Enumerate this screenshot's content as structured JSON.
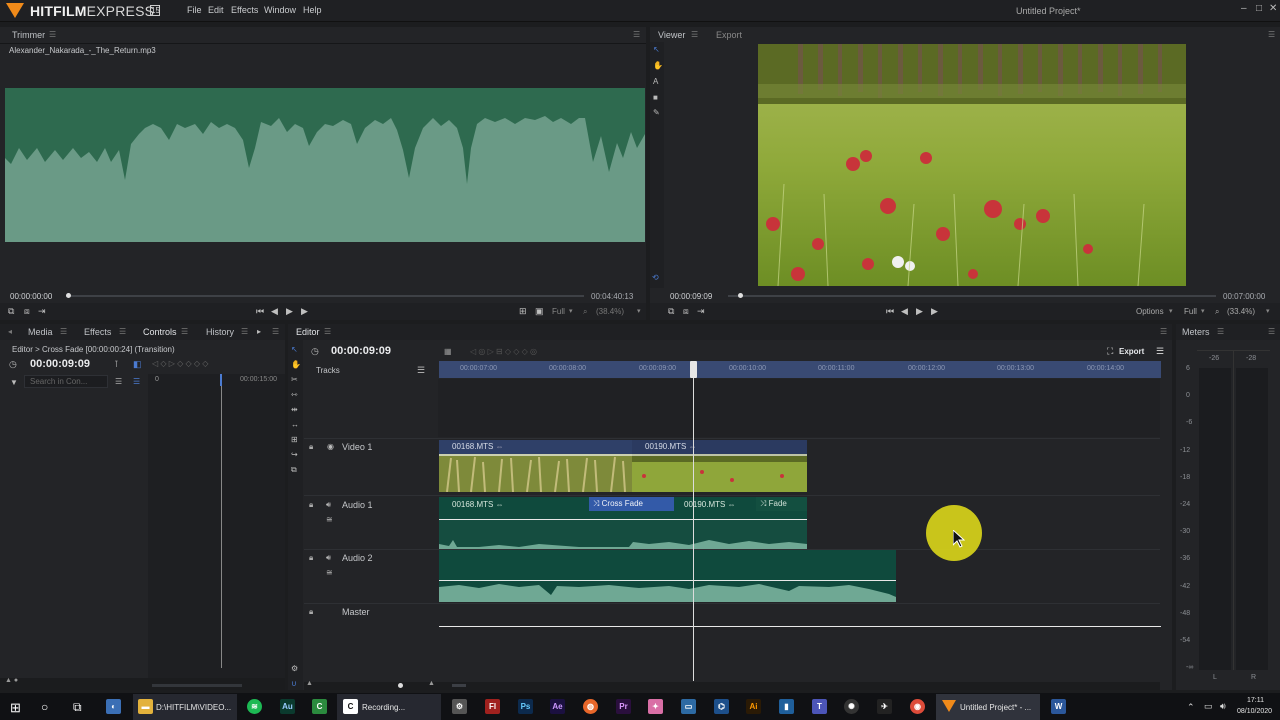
{
  "app": {
    "logo_main": "HITFILM",
    "logo_sub": "EXPRESS",
    "version_badge": "15",
    "window_title": "Untitled Project*",
    "menu": [
      "File",
      "Edit",
      "Effects",
      "Window",
      "Help"
    ]
  },
  "trimmer": {
    "tab": "Trimmer",
    "file_name": "Alexander_Nakarada_-_The_Return.mp3",
    "time_start": "00:00:00:00",
    "time_end": "00:04:40:13",
    "quality": "Full",
    "zoom": "(38.4%)",
    "scrub_fraction": 0.0
  },
  "viewer": {
    "tabs": [
      "Viewer",
      "Export"
    ],
    "time_current": "00:00:09:09",
    "time_end": "00:07:00:00",
    "options_label": "Options",
    "quality": "Full",
    "zoom": "(33.4%)",
    "scrub_fraction": 0.02
  },
  "left_panel": {
    "tabs": [
      "Media",
      "Effects",
      "Controls",
      "History"
    ],
    "breadcrumb": "Editor > Cross Fade [00:00:00:24] (Transition)",
    "time": "00:00:09:09",
    "search_placeholder": "Search in Con...",
    "value_zero": "0",
    "ruler_time": "00:00:15:00"
  },
  "editor": {
    "tab": "Editor",
    "time": "00:00:09:09",
    "export_label": "Export",
    "tracks_label": "Tracks",
    "ruler_ticks": [
      "00:00:07:00",
      "00:00:08:00",
      "00:00:09:00",
      "00:00:10:00",
      "00:00:11:00",
      "00:00:12:00",
      "00:00:13:00",
      "00:00:14:00"
    ],
    "tracks": [
      {
        "name": "Video 1",
        "clips": [
          "00168.MTS",
          "00190.MTS"
        ]
      },
      {
        "name": "Audio 1",
        "clips": [
          "00168.MTS",
          "00190.MTS"
        ],
        "transitions": [
          "Cross Fade",
          "Fade"
        ]
      },
      {
        "name": "Audio 2",
        "clips": []
      },
      {
        "name": "Master",
        "clips": []
      }
    ]
  },
  "meters": {
    "tab": "Meters",
    "header_labels": [
      "-26",
      "-28"
    ],
    "scale": [
      "6",
      "0",
      "-6",
      "-12",
      "-18",
      "-24",
      "-30",
      "-36",
      "-42",
      "-48",
      "-54",
      "-∞"
    ],
    "channels": [
      "L",
      "R"
    ]
  },
  "taskbar": {
    "items": [
      {
        "label": "D:\\HITFILM\\VIDEO...",
        "icon": "folder-icon"
      },
      {
        "label": "Recording...",
        "icon": "camtasia-icon"
      },
      {
        "label": "Untitled Project* - ...",
        "icon": "hitfilm-icon"
      }
    ],
    "clock_time": "17:11",
    "clock_date": "08/10/2020"
  },
  "colors": {
    "accent": "#f08a1a",
    "ruler": "#394a73",
    "clip_head": "#2f4068",
    "audio_clip": "#0f4a3d",
    "waveform": "#2e6a4f"
  }
}
